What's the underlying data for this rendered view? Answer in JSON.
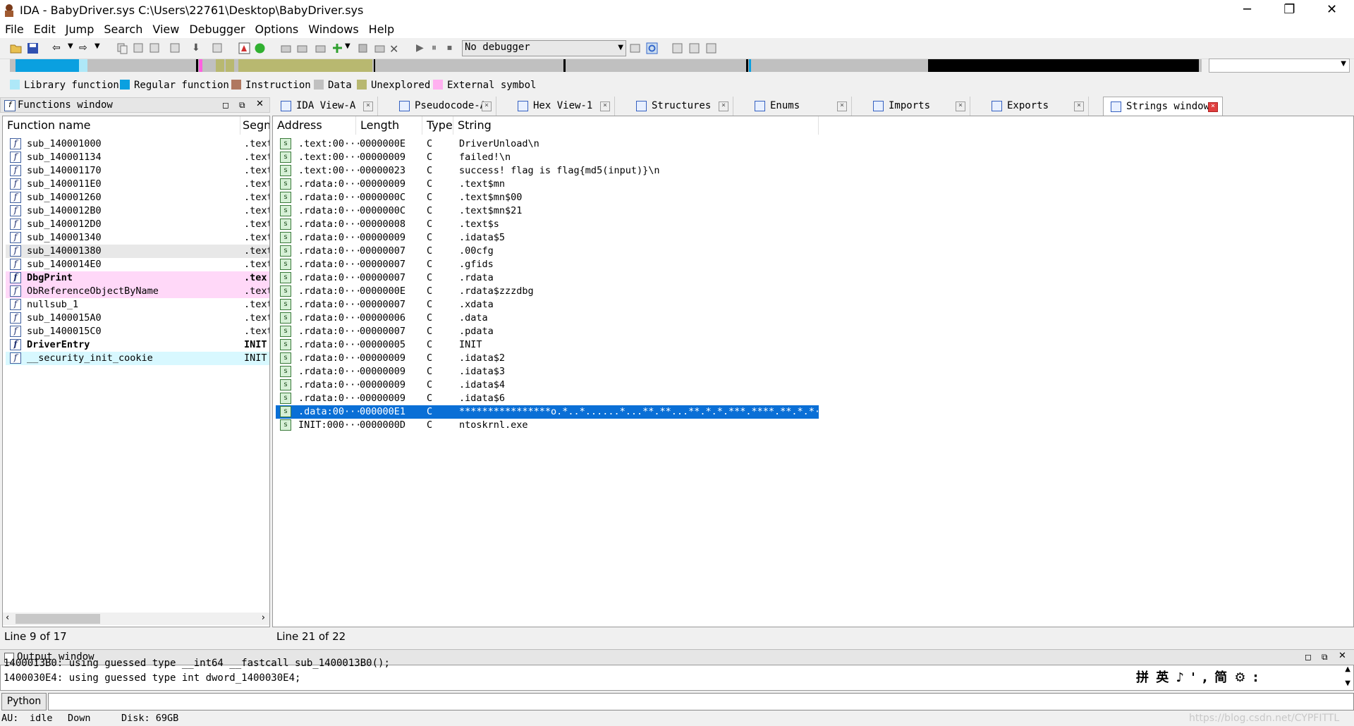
{
  "window": {
    "title": "IDA - BabyDriver.sys C:\\Users\\22761\\Desktop\\BabyDriver.sys",
    "minimize": "─",
    "restore": "❐",
    "close": "✕"
  },
  "menu": [
    "File",
    "Edit",
    "Jump",
    "Search",
    "View",
    "Debugger",
    "Options",
    "Windows",
    "Help"
  ],
  "toolbar": {
    "debugger_select": "No debugger"
  },
  "legend": [
    {
      "label": "Library function",
      "color": "#aee8f8"
    },
    {
      "label": "Regular function",
      "color": "#0aa0e0"
    },
    {
      "label": "Instruction",
      "color": "#b07860"
    },
    {
      "label": "Data",
      "color": "#c0c0c0"
    },
    {
      "label": "Unexplored",
      "color": "#b8b870"
    },
    {
      "label": "External symbol",
      "color": "#ffb0f0"
    }
  ],
  "functions_window": {
    "title": "Functions window",
    "columns": [
      "Function name",
      "Segn"
    ],
    "rows": [
      {
        "name": "sub_140001000",
        "seg": ".text"
      },
      {
        "name": "sub_140001134",
        "seg": ".text"
      },
      {
        "name": "sub_140001170",
        "seg": ".text"
      },
      {
        "name": "sub_1400011E0",
        "seg": ".text"
      },
      {
        "name": "sub_140001260",
        "seg": ".text"
      },
      {
        "name": "sub_1400012B0",
        "seg": ".text"
      },
      {
        "name": "sub_1400012D0",
        "seg": ".text"
      },
      {
        "name": "sub_140001340",
        "seg": ".text"
      },
      {
        "name": "sub_140001380",
        "seg": ".text"
      },
      {
        "name": "sub_1400014E0",
        "seg": ".text"
      },
      {
        "name": "DbgPrint",
        "seg": ".tex"
      },
      {
        "name": "ObReferenceObjectByName",
        "seg": ".text"
      },
      {
        "name": "nullsub_1",
        "seg": ".text"
      },
      {
        "name": "sub_1400015A0",
        "seg": ".text"
      },
      {
        "name": "sub_1400015C0",
        "seg": ".text"
      },
      {
        "name": "DriverEntry",
        "seg": "INIT"
      },
      {
        "name": "__security_init_cookie",
        "seg": "INIT"
      }
    ],
    "status": "Line 9 of 17"
  },
  "tabs": [
    {
      "label": "IDA View-A"
    },
    {
      "label": "Pseudocode-A"
    },
    {
      "label": "Hex View-1"
    },
    {
      "label": "Structures"
    },
    {
      "label": "Enums"
    },
    {
      "label": "Imports"
    },
    {
      "label": "Exports"
    },
    {
      "label": "Strings window"
    }
  ],
  "strings_window": {
    "columns": [
      "Address",
      "Length",
      "Type",
      "String"
    ],
    "rows": [
      {
        "addr": ".text:00···",
        "len": "0000000E",
        "type": "C",
        "str": "DriverUnload\\n"
      },
      {
        "addr": ".text:00···",
        "len": "00000009",
        "type": "C",
        "str": "failed!\\n"
      },
      {
        "addr": ".text:00···",
        "len": "00000023",
        "type": "C",
        "str": "success! flag is flag{md5(input)}\\n"
      },
      {
        "addr": ".rdata:0···",
        "len": "00000009",
        "type": "C",
        "str": ".text$mn"
      },
      {
        "addr": ".rdata:0···",
        "len": "0000000C",
        "type": "C",
        "str": ".text$mn$00"
      },
      {
        "addr": ".rdata:0···",
        "len": "0000000C",
        "type": "C",
        "str": ".text$mn$21"
      },
      {
        "addr": ".rdata:0···",
        "len": "00000008",
        "type": "C",
        "str": ".text$s"
      },
      {
        "addr": ".rdata:0···",
        "len": "00000009",
        "type": "C",
        "str": ".idata$5"
      },
      {
        "addr": ".rdata:0···",
        "len": "00000007",
        "type": "C",
        "str": ".00cfg"
      },
      {
        "addr": ".rdata:0···",
        "len": "00000007",
        "type": "C",
        "str": ".gfids"
      },
      {
        "addr": ".rdata:0···",
        "len": "00000007",
        "type": "C",
        "str": ".rdata"
      },
      {
        "addr": ".rdata:0···",
        "len": "0000000E",
        "type": "C",
        "str": ".rdata$zzzdbg"
      },
      {
        "addr": ".rdata:0···",
        "len": "00000007",
        "type": "C",
        "str": ".xdata"
      },
      {
        "addr": ".rdata:0···",
        "len": "00000006",
        "type": "C",
        "str": ".data"
      },
      {
        "addr": ".rdata:0···",
        "len": "00000007",
        "type": "C",
        "str": ".pdata"
      },
      {
        "addr": ".rdata:0···",
        "len": "00000005",
        "type": "C",
        "str": "INIT"
      },
      {
        "addr": ".rdata:0···",
        "len": "00000009",
        "type": "C",
        "str": ".idata$2"
      },
      {
        "addr": ".rdata:0···",
        "len": "00000009",
        "type": "C",
        "str": ".idata$3"
      },
      {
        "addr": ".rdata:0···",
        "len": "00000009",
        "type": "C",
        "str": ".idata$4"
      },
      {
        "addr": ".rdata:0···",
        "len": "00000009",
        "type": "C",
        "str": ".idata$6"
      },
      {
        "addr": ".data:00···",
        "len": "000000E1",
        "type": "C",
        "str": "****************o.*..*......*...**.**...**.*.*.***.****.**.*.*···"
      },
      {
        "addr": "INIT:000···",
        "len": "0000000D",
        "type": "C",
        "str": "ntoskrnl.exe"
      }
    ],
    "status": "Line 21 of 22"
  },
  "output_window": {
    "title": "Output window",
    "line1": "1400013B0: using guessed type __int64 __fastcall sub_1400013B0();",
    "line2": "1400030E4: using guessed type int dword_1400030E4;",
    "ime": "拼 英 ♪ ' , 简 ⚙ :"
  },
  "python_button": "Python",
  "statusbar": {
    "au": "AU:",
    "state": "idle",
    "dir": "Down",
    "disk": "Disk: 69GB"
  },
  "watermark": "https://blog.csdn.net/CYPFITTL"
}
